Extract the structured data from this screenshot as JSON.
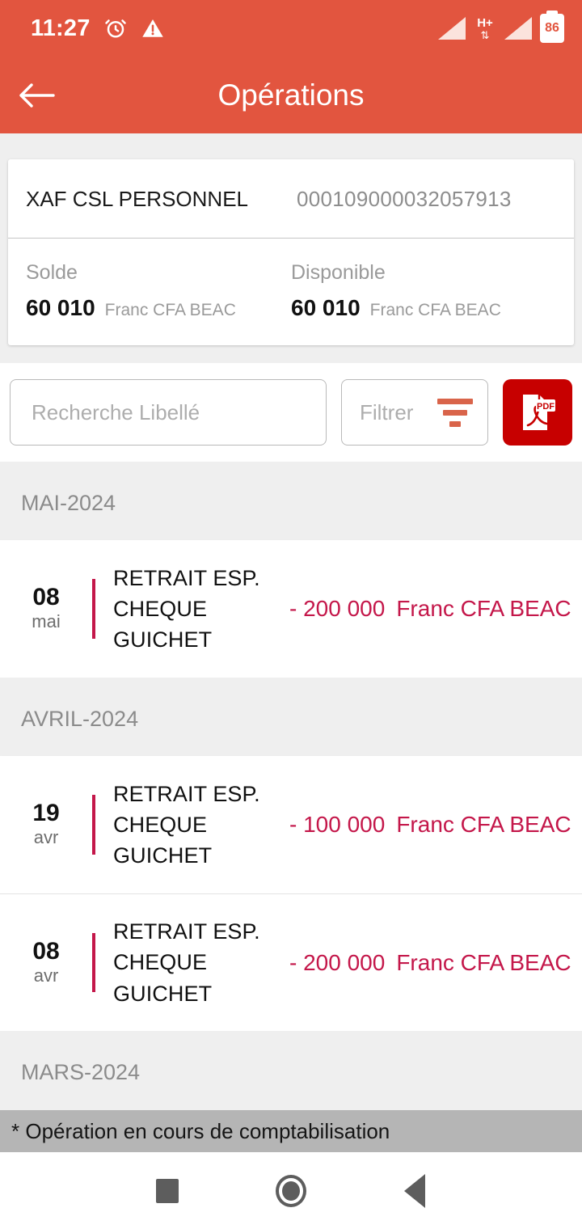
{
  "statusbar": {
    "time": "11:27",
    "alarm_icon": "alarm-clock-icon",
    "warning_icon": "warning-triangle-icon",
    "signal_icon": "signal-bars-icon",
    "network_type": "H+",
    "data_arrows": "⇅",
    "battery_level": "86"
  },
  "appbar": {
    "back_icon": "arrow-left-icon",
    "title": "Opérations"
  },
  "account": {
    "name": "XAF CSL PERSONNEL",
    "number": "000109000032057913",
    "balance_label": "Solde",
    "balance_amount": "60 010",
    "balance_currency": "Franc CFA BEAC",
    "available_label": "Disponible",
    "available_amount": "60 010",
    "available_currency": "Franc CFA BEAC"
  },
  "tools": {
    "search_placeholder": "Recherche Libellé",
    "search_value": "",
    "filter_label": "Filtrer",
    "filter_icon": "funnel-icon",
    "pdf_icon": "pdf-document-icon"
  },
  "months": [
    {
      "header": "MAI-2024",
      "transactions": [
        {
          "day": "08",
          "month": "mai",
          "label": "RETRAIT ESP. CHEQUE GUICHET",
          "amount": "- 200 000",
          "currency": "Franc CFA BEAC"
        }
      ]
    },
    {
      "header": "AVRIL-2024",
      "transactions": [
        {
          "day": "19",
          "month": "avr",
          "label": "RETRAIT ESP. CHEQUE GUICHET",
          "amount": "- 100 000",
          "currency": "Franc CFA BEAC"
        },
        {
          "day": "08",
          "month": "avr",
          "label": "RETRAIT ESP. CHEQUE GUICHET",
          "amount": "- 200 000",
          "currency": "Franc CFA BEAC"
        }
      ]
    },
    {
      "header": "MARS-2024",
      "transactions": []
    }
  ],
  "footer": {
    "note": "* Opération en cours de comptabilisation"
  },
  "navbar": {
    "recents_icon": "square-recents-icon",
    "home_icon": "circle-home-icon",
    "back_icon": "triangle-back-icon"
  },
  "colors": {
    "header": "#e2553f",
    "accent_amount": "#c4174a",
    "pdf_button": "#c70000",
    "filter_icon": "#d9644a",
    "page_bg": "#efefef",
    "footer_bg": "#b5b5b5"
  }
}
